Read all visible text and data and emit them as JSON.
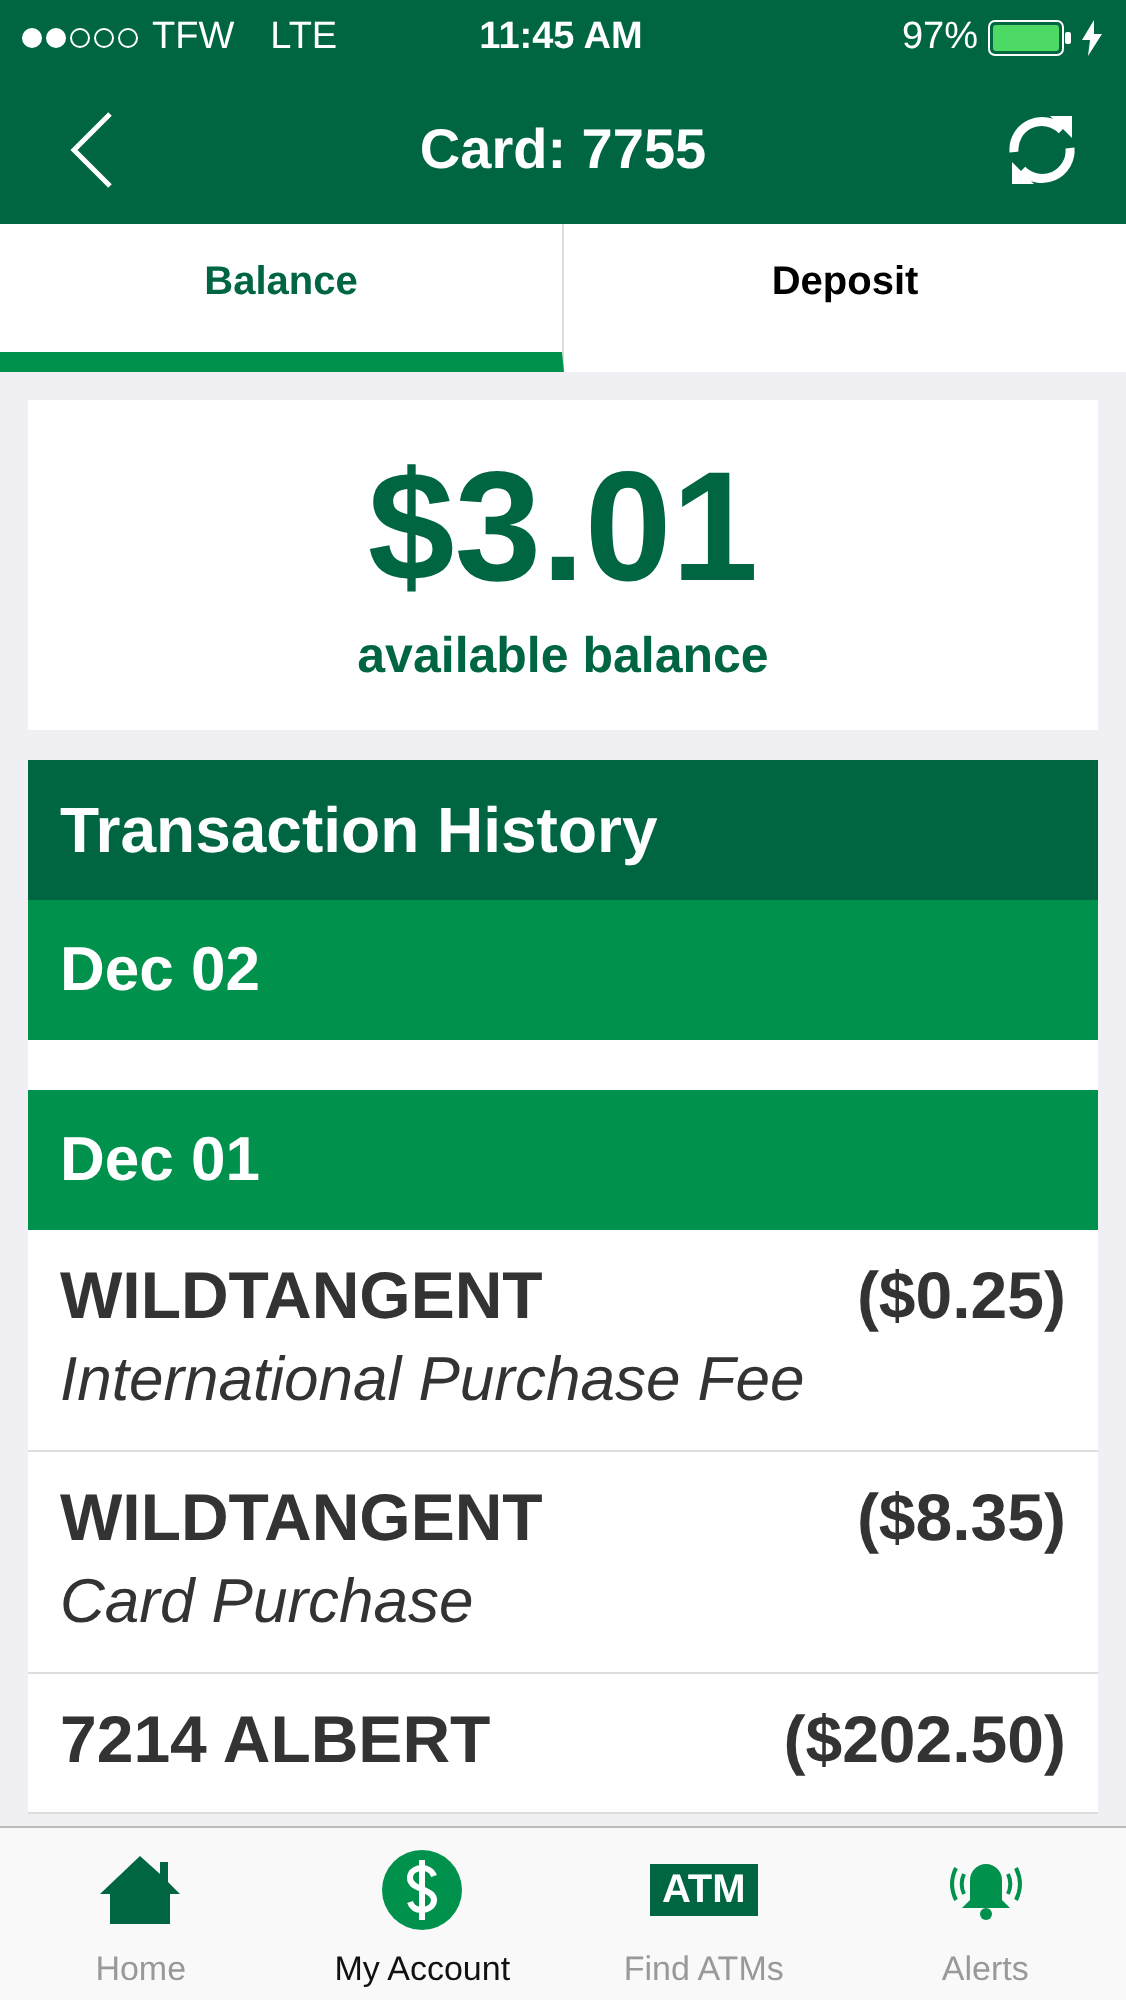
{
  "status_bar": {
    "carrier": "TFW",
    "network": "LTE",
    "time": "11:45 AM",
    "battery": "97%"
  },
  "nav": {
    "title": "Card: 7755"
  },
  "tabs": [
    {
      "label": "Balance",
      "selected": true
    },
    {
      "label": "Deposit",
      "selected": false
    }
  ],
  "balance": {
    "amount": "$3.01",
    "caption": "available balance"
  },
  "history": {
    "title": "Transaction History",
    "days": [
      {
        "date": "Dec 02"
      },
      {
        "date": "Dec 01",
        "transactions": [
          {
            "merchant": "WILDTANGENT",
            "amount": "($0.25)",
            "description": "International Purchase Fee"
          },
          {
            "merchant": "WILDTANGENT",
            "amount": "($8.35)",
            "description": "Card Purchase"
          },
          {
            "merchant": "7214 ALBERT",
            "amount": "($202.50)"
          }
        ]
      }
    ]
  },
  "tab_bar": [
    {
      "kind": "home",
      "label": "Home",
      "selected": false
    },
    {
      "kind": "account",
      "label": "My Account",
      "selected": true
    },
    {
      "kind": "atm",
      "label": "Find ATMs",
      "icon_text": "ATM",
      "selected": false
    },
    {
      "kind": "alerts",
      "label": "Alerts",
      "selected": false
    }
  ]
}
